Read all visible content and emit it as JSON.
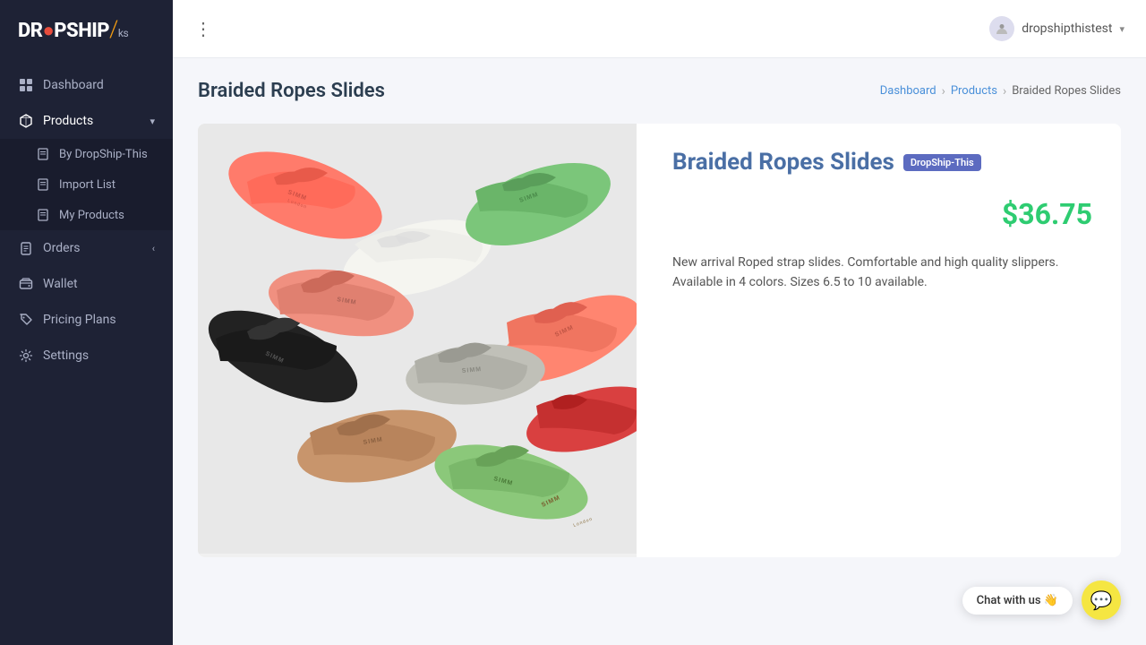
{
  "app": {
    "name": "DROPSHIP",
    "logo_text": "DR●PSHIP/ks"
  },
  "header": {
    "menu_icon": "☰",
    "user": "dropshipthistest",
    "chevron": "▾"
  },
  "sidebar": {
    "items": [
      {
        "id": "dashboard",
        "label": "Dashboard",
        "icon": "grid"
      },
      {
        "id": "products",
        "label": "Products",
        "icon": "box",
        "active": true,
        "expanded": true
      },
      {
        "id": "orders",
        "label": "Orders",
        "icon": "clipboard"
      },
      {
        "id": "wallet",
        "label": "Wallet",
        "icon": "wallet"
      },
      {
        "id": "pricing-plans",
        "label": "Pricing Plans",
        "icon": "tag"
      },
      {
        "id": "settings",
        "label": "Settings",
        "icon": "gear"
      }
    ],
    "submenu": [
      {
        "id": "by-dropship-this",
        "label": "By DropShip-This"
      },
      {
        "id": "import-list",
        "label": "Import List"
      },
      {
        "id": "my-products",
        "label": "My Products"
      }
    ]
  },
  "breadcrumb": {
    "items": [
      {
        "label": "Dashboard",
        "href": "#"
      },
      {
        "label": "Products",
        "href": "#"
      },
      {
        "label": "Braided Ropes Slides",
        "current": true
      }
    ]
  },
  "page": {
    "title": "Braided Ropes Slides"
  },
  "product": {
    "name": "Braided Ropes Slides",
    "badge": "DropShip-This",
    "price": "$36.75",
    "description": "New arrival Roped strap slides. Comfortable and high quality slippers. Available in 4 colors. Sizes 6.5 to 10 available."
  },
  "chat": {
    "label": "Chat with us 👋",
    "icon": "💬"
  }
}
